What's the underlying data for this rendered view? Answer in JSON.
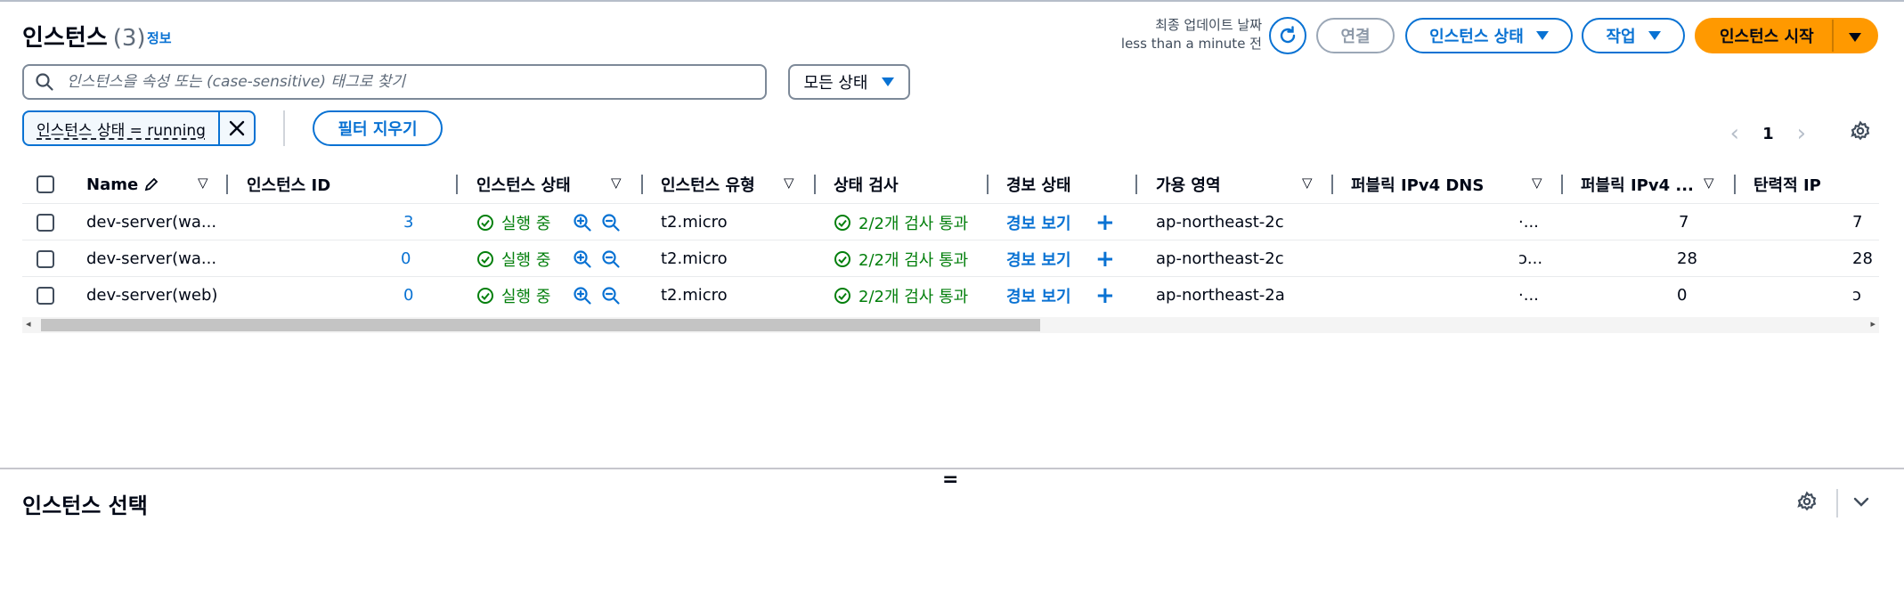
{
  "header": {
    "title": "인스턴스",
    "count": "(3)",
    "info_link": "정보",
    "last_updated_label": "최종 업데이트 날짜",
    "last_updated_value": "less than a minute 전"
  },
  "toolbar": {
    "connect_label": "연결",
    "instance_state_label": "인스턴스 상태",
    "actions_label": "작업",
    "launch_label": "인스턴스 시작"
  },
  "search": {
    "placeholder": "인스턴스을 속성 또는 (case-sensitive) 태그로 찾기"
  },
  "filter": {
    "state_select_value": "모든 상태",
    "token_label": "인스턴스 상태 = running",
    "clear_filters_label": "필터 지우기"
  },
  "pagination": {
    "current_page": "1"
  },
  "table": {
    "columns": [
      "Name",
      "인스턴스 ID",
      "인스턴스 상태",
      "인스턴스 유형",
      "상태 검사",
      "경보 상태",
      "가용 영역",
      "퍼블릭 IPv4 DNS",
      "퍼블릭 IPv4 ...",
      "탄력적 IP"
    ],
    "rows": [
      {
        "name": "dev-server(wa...",
        "instance_id": "3",
        "state": "실행 중",
        "type": "t2.micro",
        "check": "2/2개 검사 통과",
        "alarm": "경보 보기",
        "az": "ap-northeast-2c",
        "dns": "·...",
        "ipv4": "7",
        "eip": "7"
      },
      {
        "name": "dev-server(wa...",
        "instance_id": "0",
        "state": "실행 중",
        "type": "t2.micro",
        "check": "2/2개 검사 통과",
        "alarm": "경보 보기",
        "az": "ap-northeast-2c",
        "dns": "ɔ...",
        "ipv4": "28",
        "eip": "28"
      },
      {
        "name": "dev-server(web)",
        "instance_id": "0",
        "state": "실행 중",
        "type": "t2.micro",
        "check": "2/2개 검사 통과",
        "alarm": "경보 보기",
        "az": "ap-northeast-2a",
        "dns": "·...",
        "ipv4": "0",
        "eip": "ɔ"
      }
    ]
  },
  "bottom_panel": {
    "title": "인스턴스 선택",
    "drag_handle": "="
  },
  "colors": {
    "link": "#0972d3",
    "primary": "#ff9900",
    "success": "#037f0c"
  }
}
